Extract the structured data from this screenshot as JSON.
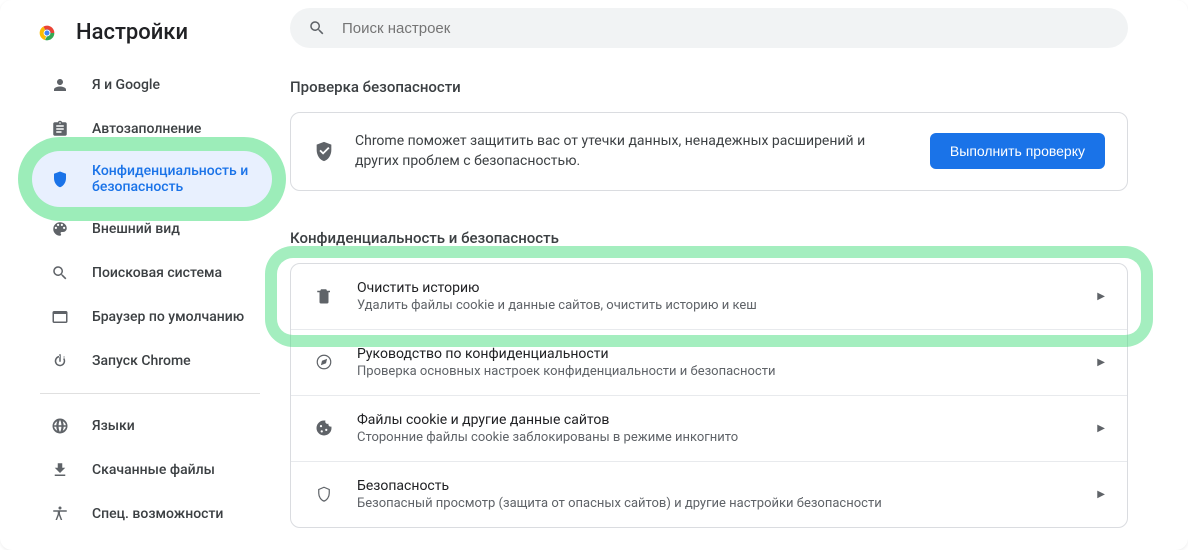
{
  "header": {
    "title": "Настройки"
  },
  "search": {
    "placeholder": "Поиск настроек"
  },
  "sidebar": {
    "items": [
      {
        "id": "you-and-google",
        "label": "Я и Google"
      },
      {
        "id": "autofill",
        "label": "Автозаполнение"
      },
      {
        "id": "privacy",
        "label": "Конфиденциальность и безопасность",
        "active": true,
        "highlighted": true
      },
      {
        "id": "appearance",
        "label": "Внешний вид"
      },
      {
        "id": "search-engine",
        "label": "Поисковая система"
      },
      {
        "id": "default-browser",
        "label": "Браузер по умолчанию"
      },
      {
        "id": "on-startup",
        "label": "Запуск Chrome"
      }
    ],
    "items2": [
      {
        "id": "languages",
        "label": "Языки"
      },
      {
        "id": "downloads",
        "label": "Скачанные файлы"
      },
      {
        "id": "accessibility",
        "label": "Спец. возможности"
      }
    ]
  },
  "sections": {
    "safety_check": {
      "title": "Проверка безопасности",
      "message": "Chrome поможет защитить вас от утечки данных, ненадежных расширений и других проблем с безопасностью.",
      "button": "Выполнить проверку"
    },
    "privacy": {
      "title": "Конфиденциальность и безопасность",
      "rows": [
        {
          "title": "Очистить историю",
          "sub": "Удалить файлы cookie и данные сайтов, очистить историю и кеш",
          "highlighted": true
        },
        {
          "title": "Руководство по конфиденциальности",
          "sub": "Проверка основных настроек конфиденциальности и безопасности"
        },
        {
          "title": "Файлы cookie и другие данные сайтов",
          "sub": "Сторонние файлы cookie заблокированы в режиме инкогнито"
        },
        {
          "title": "Безопасность",
          "sub": "Безопасный просмотр (защита от опасных сайтов) и другие настройки безопасности"
        }
      ]
    }
  }
}
